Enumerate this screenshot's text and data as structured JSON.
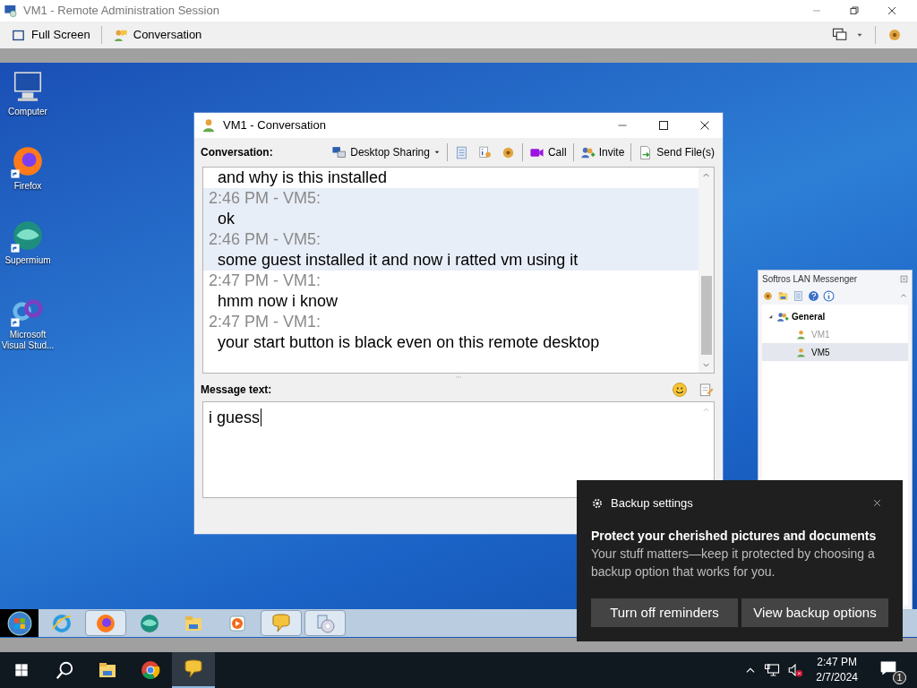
{
  "session_window": {
    "title": "VM1 - Remote Administration Session",
    "toolbar": [
      {
        "kind": "fullscreen",
        "label": "Full Screen"
      },
      {
        "kind": "conversation",
        "label": "Conversation"
      }
    ]
  },
  "desktop_icons": [
    {
      "kind": "computer",
      "label": "Computer",
      "shortcut": false
    },
    {
      "kind": "firefox",
      "label": "Firefox",
      "shortcut": true
    },
    {
      "kind": "supermium",
      "label": "Supermium",
      "shortcut": true
    },
    {
      "kind": "vs",
      "label": "Microsoft Visual Stud...",
      "shortcut": true
    }
  ],
  "conversation_window": {
    "title": "VM1 - Conversation",
    "conversation_label": "Conversation:",
    "toolbar": [
      {
        "kind": "desktop",
        "label": "Desktop Sharing"
      },
      {
        "kind": "log"
      },
      {
        "kind": "info"
      },
      {
        "kind": "settings"
      },
      {
        "kind": "call",
        "label": "Call"
      },
      {
        "kind": "invite",
        "label": "Invite"
      },
      {
        "kind": "send",
        "label": "Send File(s)"
      }
    ],
    "messages": [
      {
        "kind": "body",
        "text": "and why is this installed",
        "highlighted": false
      },
      {
        "kind": "header",
        "text": "2:46 PM - VM5:",
        "highlighted": true
      },
      {
        "kind": "body",
        "text": "ok",
        "highlighted": true
      },
      {
        "kind": "header",
        "text": "2:46 PM - VM5:",
        "highlighted": true
      },
      {
        "kind": "body",
        "text": "some guest installed it and now i ratted vm using it",
        "highlighted": true
      },
      {
        "kind": "header",
        "text": "2:47 PM - VM1:",
        "highlighted": false
      },
      {
        "kind": "body",
        "text": "hmm now i know",
        "highlighted": false
      },
      {
        "kind": "header",
        "text": "2:47 PM - VM1:",
        "highlighted": false
      },
      {
        "kind": "body",
        "text": "your start button is black even on this remote desktop",
        "highlighted": false
      }
    ],
    "message_label": "Message text:",
    "message_value": "i guess"
  },
  "messenger": {
    "title": "Softros LAN Messenger",
    "groups": [
      {
        "label": "General",
        "expanded": true,
        "children": [
          {
            "label": "VM1",
            "selected": false,
            "dimmed": true
          },
          {
            "label": "VM5",
            "selected": true,
            "dimmed": false
          }
        ]
      }
    ]
  },
  "notification": {
    "app": "Backup settings",
    "heading": "Protect your cherished pictures and documents",
    "body": "Your stuff matters—keep it protected by choosing a backup option that works for you.",
    "buttons": [
      "Turn off reminders",
      "View backup options"
    ]
  },
  "remote_taskbar": [
    {
      "kind": "ie",
      "open": false
    },
    {
      "kind": "firefox",
      "open": true
    },
    {
      "kind": "supermium",
      "open": false
    },
    {
      "kind": "explorer",
      "open": false
    },
    {
      "kind": "media",
      "open": false
    },
    {
      "kind": "messenger",
      "open": true
    },
    {
      "kind": "disc",
      "open": true
    }
  ],
  "taskbar": {
    "apps": [
      {
        "kind": "explorer",
        "active": false
      },
      {
        "kind": "chrome",
        "active": false
      },
      {
        "kind": "messenger",
        "active": true
      }
    ],
    "time": "2:47 PM",
    "date": "2/7/2024",
    "notification_count": "1"
  }
}
